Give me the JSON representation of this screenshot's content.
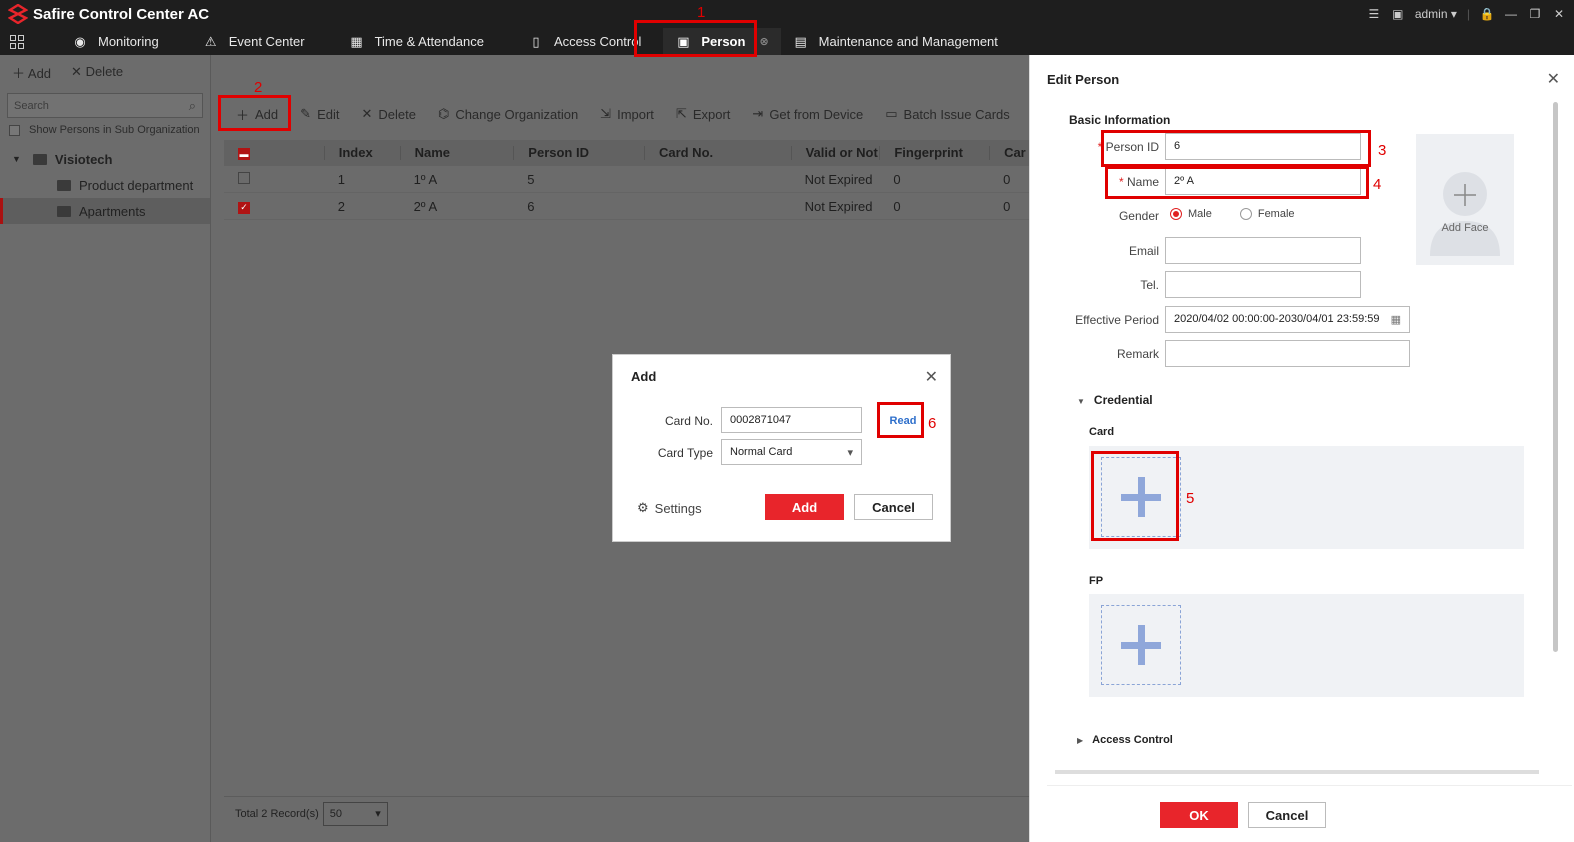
{
  "app": {
    "title": "Safire Control Center AC",
    "user": "admin"
  },
  "nav": [
    {
      "label": "Monitoring"
    },
    {
      "label": "Event Center"
    },
    {
      "label": "Time & Attendance"
    },
    {
      "label": "Access Control"
    },
    {
      "label": "Person"
    },
    {
      "label": "Maintenance and Management"
    }
  ],
  "left_panel": {
    "add": "Add",
    "delete": "Delete",
    "search_placeholder": "Search",
    "show_sub": "Show Persons in Sub Organization",
    "root": "Visiotech",
    "children": [
      "Product department",
      "Apartments"
    ]
  },
  "toolbar": {
    "add": "Add",
    "edit": "Edit",
    "delete": "Delete",
    "change_org": "Change Organization",
    "import": "Import",
    "export": "Export",
    "get_from_device": "Get from Device",
    "batch_issue": "Batch Issue Cards"
  },
  "table": {
    "headers": [
      "Index",
      "Name",
      "Person ID",
      "Card No.",
      "Valid or Not",
      "Fingerprint",
      "Car"
    ],
    "rows": [
      {
        "index": "1",
        "name": "1º A",
        "pid": "5",
        "card": "",
        "valid": "Not Expired",
        "fp": "0",
        "card2": "0"
      },
      {
        "index": "2",
        "name": "2º A",
        "pid": "6",
        "card": "",
        "valid": "Not Expired",
        "fp": "0",
        "card2": "0"
      }
    ]
  },
  "footer": {
    "total": "Total 2 Record(s)",
    "page_size": "50"
  },
  "edit_person": {
    "title": "Edit Person",
    "basic_info": "Basic Information",
    "person_id_label": "Person ID",
    "person_id": "6",
    "name_label": "Name",
    "name": "2º A",
    "gender_label": "Gender",
    "male": "Male",
    "female": "Female",
    "email_label": "Email",
    "tel_label": "Tel.",
    "period_label": "Effective Period",
    "period": "2020/04/02 00:00:00-2030/04/01 23:59:59",
    "remark_label": "Remark",
    "add_face": "Add Face",
    "credential": "Credential",
    "card": "Card",
    "fp": "FP",
    "access_control": "Access Control",
    "ok": "OK",
    "cancel": "Cancel"
  },
  "add_dialog": {
    "title": "Add",
    "card_no_label": "Card No.",
    "card_no": "0002871047",
    "read": "Read",
    "card_type_label": "Card Type",
    "card_type": "Normal Card",
    "settings": "Settings",
    "add": "Add",
    "cancel": "Cancel"
  },
  "annotations": [
    "1",
    "2",
    "3",
    "4",
    "5",
    "6"
  ],
  "colors": {
    "accent": "#e8252b",
    "annotation": "#e00000",
    "link": "#2e6fcb"
  }
}
